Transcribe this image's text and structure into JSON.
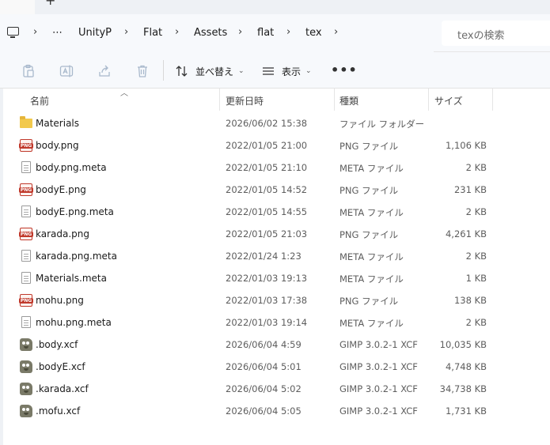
{
  "window": {
    "new_tab_glyph": "+"
  },
  "breadcrumb": {
    "overflow": "⋯",
    "items": [
      "UnityP",
      "Flat",
      "Assets",
      "flat",
      "tex"
    ]
  },
  "search": {
    "placeholder": "texの検索"
  },
  "toolbar": {
    "sort_label": "並べ替え",
    "view_label": "表示",
    "more": "•••"
  },
  "columns": {
    "name": "名前",
    "date": "更新日時",
    "type": "種類",
    "size": "サイズ"
  },
  "files": [
    {
      "name": "Materials",
      "date": "2026/06/02 15:38",
      "type": "ファイル フォルダー",
      "size": "",
      "icon": "folder-icon"
    },
    {
      "name": "body.png",
      "date": "2022/01/05 21:00",
      "type": "PNG ファイル",
      "size": "1,106 KB",
      "icon": "png-file-icon"
    },
    {
      "name": "body.png.meta",
      "date": "2022/01/05 21:10",
      "type": "META ファイル",
      "size": "2 KB",
      "icon": "document-icon"
    },
    {
      "name": "bodyE.png",
      "date": "2022/01/05 14:52",
      "type": "PNG ファイル",
      "size": "231 KB",
      "icon": "png-file-icon"
    },
    {
      "name": "bodyE.png.meta",
      "date": "2022/01/05 14:55",
      "type": "META ファイル",
      "size": "2 KB",
      "icon": "document-icon"
    },
    {
      "name": "karada.png",
      "date": "2022/01/05 21:03",
      "type": "PNG ファイル",
      "size": "4,261 KB",
      "icon": "png-file-icon"
    },
    {
      "name": "karada.png.meta",
      "date": "2022/01/24 1:23",
      "type": "META ファイル",
      "size": "2 KB",
      "icon": "document-icon"
    },
    {
      "name": "Materials.meta",
      "date": "2022/01/03 19:13",
      "type": "META ファイル",
      "size": "1 KB",
      "icon": "document-icon"
    },
    {
      "name": "mohu.png",
      "date": "2022/01/03 17:38",
      "type": "PNG ファイル",
      "size": "138 KB",
      "icon": "png-file-icon"
    },
    {
      "name": "mohu.png.meta",
      "date": "2022/01/03 19:14",
      "type": "META ファイル",
      "size": "2 KB",
      "icon": "document-icon"
    },
    {
      "name": ".body.xcf",
      "date": "2026/06/04 4:59",
      "type": "GIMP 3.0.2-1 XCF",
      "size": "10,035 KB",
      "icon": "gimp-file-icon"
    },
    {
      "name": ".bodyE.xcf",
      "date": "2026/06/04 5:01",
      "type": "GIMP 3.0.2-1 XCF",
      "size": "4,748 KB",
      "icon": "gimp-file-icon"
    },
    {
      "name": ".karada.xcf",
      "date": "2026/06/04 5:02",
      "type": "GIMP 3.0.2-1 XCF",
      "size": "34,738 KB",
      "icon": "gimp-file-icon"
    },
    {
      "name": ".mofu.xcf",
      "date": "2026/06/04 5:05",
      "type": "GIMP 3.0.2-1 XCF",
      "size": "1,731 KB",
      "icon": "gimp-file-icon"
    }
  ]
}
